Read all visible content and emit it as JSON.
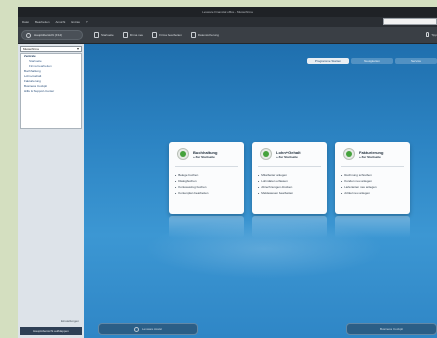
{
  "window": {
    "title": "Lexware Financial office - Musterfirma"
  },
  "menu": [
    "Datei",
    "Bearbeiten",
    "Ansicht",
    "Extras",
    "?"
  ],
  "toolbar": {
    "home_label": "Hauptübersicht (F12)",
    "tools": [
      {
        "label": "Startseite",
        "icon": "page-icon"
      },
      {
        "label": "Firma neu",
        "icon": "document-icon"
      },
      {
        "label": "Firma bearbeiten",
        "icon": "edit-icon"
      },
      {
        "label": "Datensicherung",
        "icon": "disk-icon"
      }
    ],
    "right_label": "Tipp"
  },
  "sidebar": {
    "select_value": "Musterfirma",
    "tree": [
      {
        "label": "Zentrale",
        "type": "head"
      },
      {
        "label": "Startseite",
        "type": "sub"
      },
      {
        "label": "Firma bearbeiten",
        "type": "sub"
      },
      {
        "label": "Buchhaltung",
        "type": "item"
      },
      {
        "label": "Lohn+Gehalt",
        "type": "item"
      },
      {
        "label": "Fakturierung",
        "type": "item"
      },
      {
        "label": "Business Cockpit",
        "type": "item"
      },
      {
        "label": "Hilfe & Support-Center",
        "type": "item"
      }
    ],
    "footer_text": "Einstellungen",
    "bottom_button": "Hauptübersicht aufklappen"
  },
  "tabs": [
    {
      "label": "Programme Starten",
      "active": true
    },
    {
      "label": "Neuigkeiten",
      "active": false
    },
    {
      "label": "Service",
      "active": false
    }
  ],
  "cards": [
    {
      "title": "Buchhaltung",
      "subtitle": "» Zur Startseite",
      "items": [
        "Belege buchen",
        "Dialogbuchen",
        "Kontoauszug buchen",
        "Kontenplan bearbeiten"
      ]
    },
    {
      "title": "Lohn+Gehalt",
      "subtitle": "» Zur Startseite",
      "items": [
        "Mitarbeiter anlegen",
        "Lohndaten erfassen",
        "Abrechnungen drucken",
        "Meldewesen bearbeiten"
      ]
    },
    {
      "title": "Fakturierung",
      "subtitle": "» Zur Startseite",
      "items": [
        "Rechnung schreiben",
        "Kunden neu anlegen",
        "Lieferanten neu anlegen",
        "Artikel neu anlegen"
      ]
    }
  ],
  "bottom_buttons": {
    "left": "Lexware Assist",
    "right": "Business Cockpit"
  }
}
